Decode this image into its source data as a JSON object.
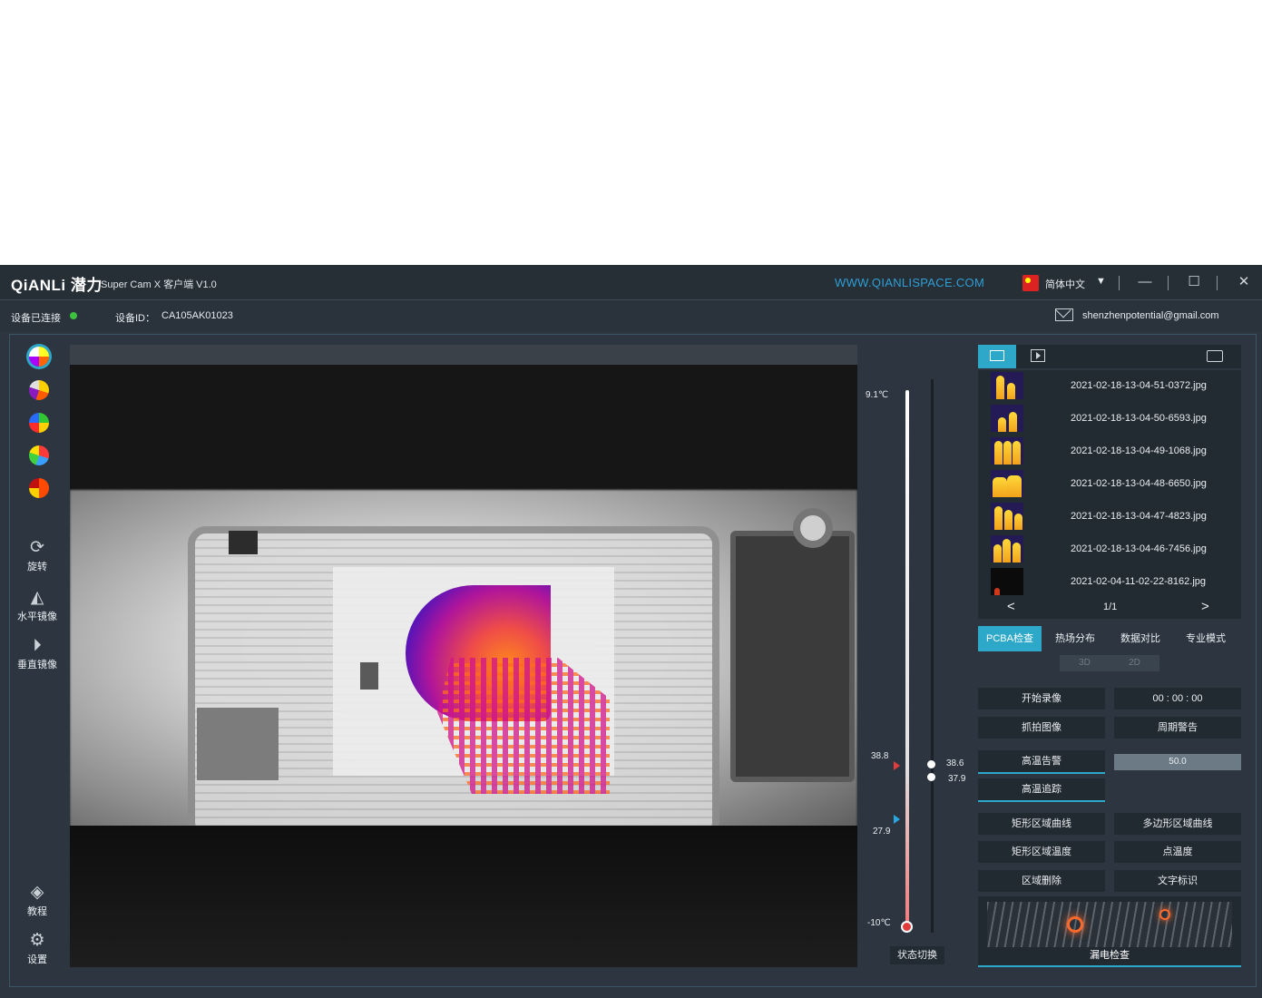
{
  "titlebar": {
    "logo": "QiANLi 潜力",
    "app_name": "Super Cam X 客户端 V1.0",
    "url": "WWW.QIANLISPACE.COM",
    "language": "简体中文",
    "minimize": "—",
    "maximize": "☐",
    "close": "✕"
  },
  "statusbar": {
    "connected": "设备已连接",
    "device_id_label": "设备ID：",
    "device_id": "CA105AK01023",
    "email": "shenzhenpotential@gmail.com",
    "status_color": "#3cc23c"
  },
  "left_toolbar": {
    "palettes": [
      "palette-1",
      "palette-2",
      "palette-3",
      "palette-4",
      "palette-5"
    ],
    "rotate": "旋转",
    "mirror_h": "水平镜像",
    "mirror_v": "垂直镜像",
    "tutorial": "教程",
    "settings": "设置"
  },
  "scale": {
    "max": "9.1℃",
    "upper": "38.8",
    "lower": "27.9",
    "min": "-10℃",
    "cursor_high": "38.6",
    "cursor_low": "37.9",
    "state_switch": "状态切换"
  },
  "gallery": {
    "items": [
      {
        "name": "2021-02-18-13-04-51-0372.jpg"
      },
      {
        "name": "2021-02-18-13-04-50-6593.jpg"
      },
      {
        "name": "2021-02-18-13-04-49-1068.jpg"
      },
      {
        "name": "2021-02-18-13-04-48-6650.jpg"
      },
      {
        "name": "2021-02-18-13-04-47-4823.jpg"
      },
      {
        "name": "2021-02-18-13-04-46-7456.jpg"
      },
      {
        "name": "2021-02-04-11-02-22-8162.jpg"
      }
    ],
    "page": "1/1",
    "prev": "<",
    "next": ">"
  },
  "modes": {
    "tabs": [
      "PCBA检查",
      "热场分布",
      "数据对比",
      "专业模式"
    ],
    "active": "PCBA检查",
    "dim_3d": "3D",
    "dim_2d": "2D"
  },
  "controls": {
    "record": "开始录像",
    "record_time": "00 : 00 : 00",
    "snapshot": "抓拍图像",
    "stop_listen": "周期警告",
    "high_temp_alarm": "高温告警",
    "alarm_value": "50.0",
    "high_temp_track": "高温追踪",
    "rect_curve": "矩形区域曲线",
    "poly_curve": "多边形区域曲线",
    "rect_temp": "矩形区域温度",
    "point_temp": "点温度",
    "region_delete": "区域删除",
    "text_mark": "文字标识",
    "leak_check": "漏电检查"
  },
  "colors": {
    "accent": "#2ea8c9",
    "url": "#2f9fd6",
    "bg": "#2d3640"
  }
}
